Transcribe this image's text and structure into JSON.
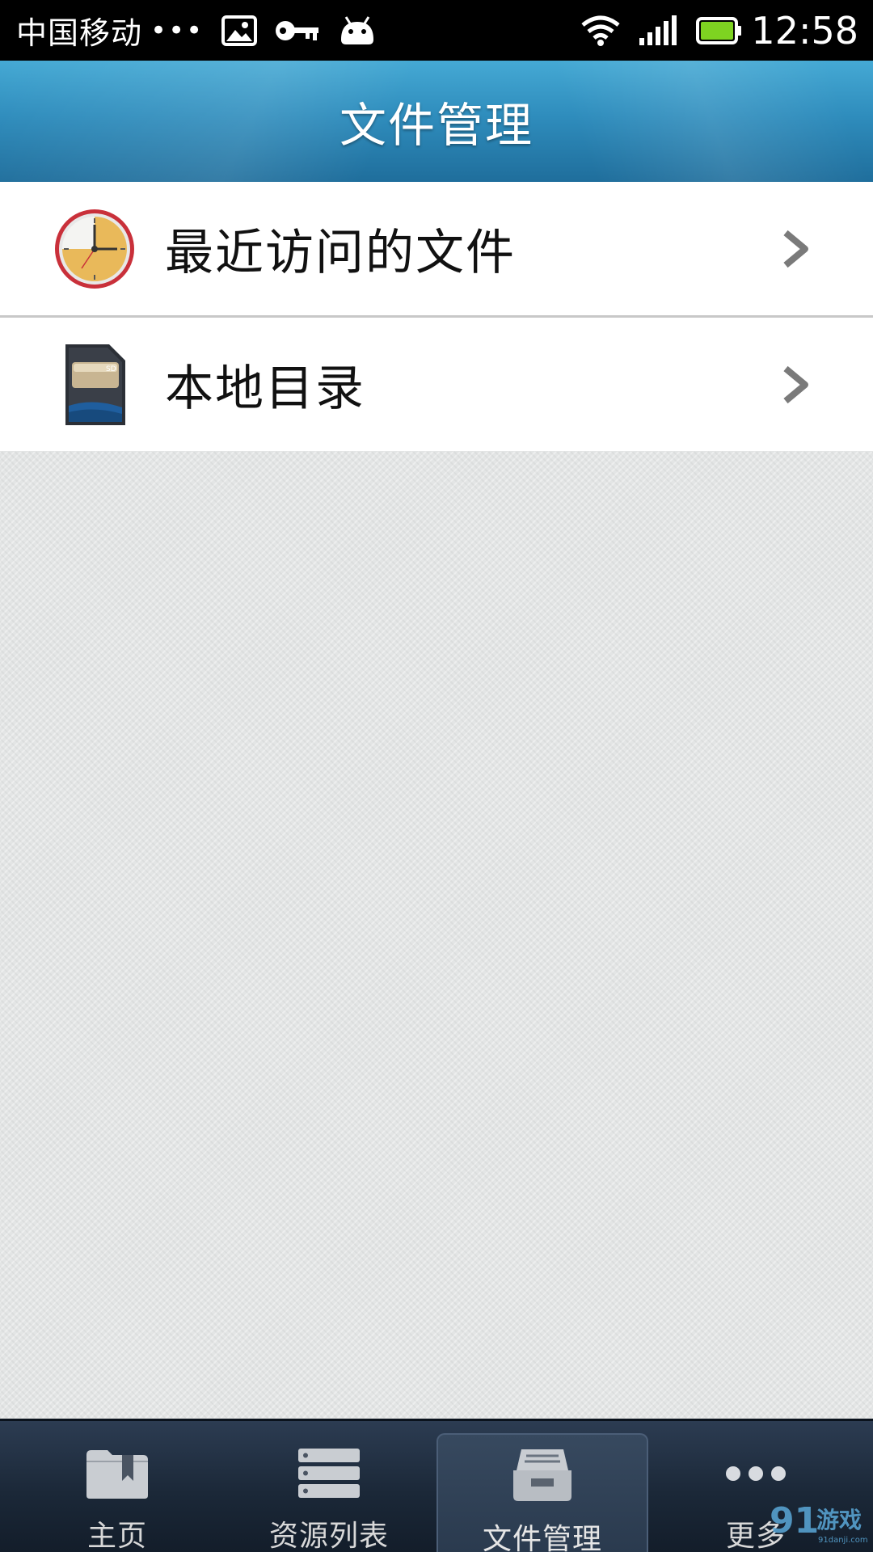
{
  "status_bar": {
    "carrier": "中国移动",
    "dots": "•••",
    "time": "12:58",
    "icons": [
      "image-icon",
      "key-icon",
      "android-icon",
      "wifi-icon",
      "signal-icon",
      "battery-icon"
    ],
    "battery_color": "#7ed321"
  },
  "header": {
    "title": "文件管理"
  },
  "menu": {
    "items": [
      {
        "label": "最近访问的文件",
        "icon": "clock-icon"
      },
      {
        "label": "本地目录",
        "icon": "sd-card-icon"
      }
    ]
  },
  "tab_bar": {
    "tabs": [
      {
        "label": "主页",
        "icon": "folder-bookmark-icon",
        "active": false
      },
      {
        "label": "资源列表",
        "icon": "server-list-icon",
        "active": false
      },
      {
        "label": "文件管理",
        "icon": "file-tray-icon",
        "active": true
      },
      {
        "label": "更多",
        "icon": "more-dots-icon",
        "active": false
      }
    ]
  },
  "colors": {
    "header_top": "#45a9d4",
    "header_bottom": "#1f6e9c",
    "tab_bar": "#1b2838",
    "content_bg": "#e3e5e5"
  }
}
